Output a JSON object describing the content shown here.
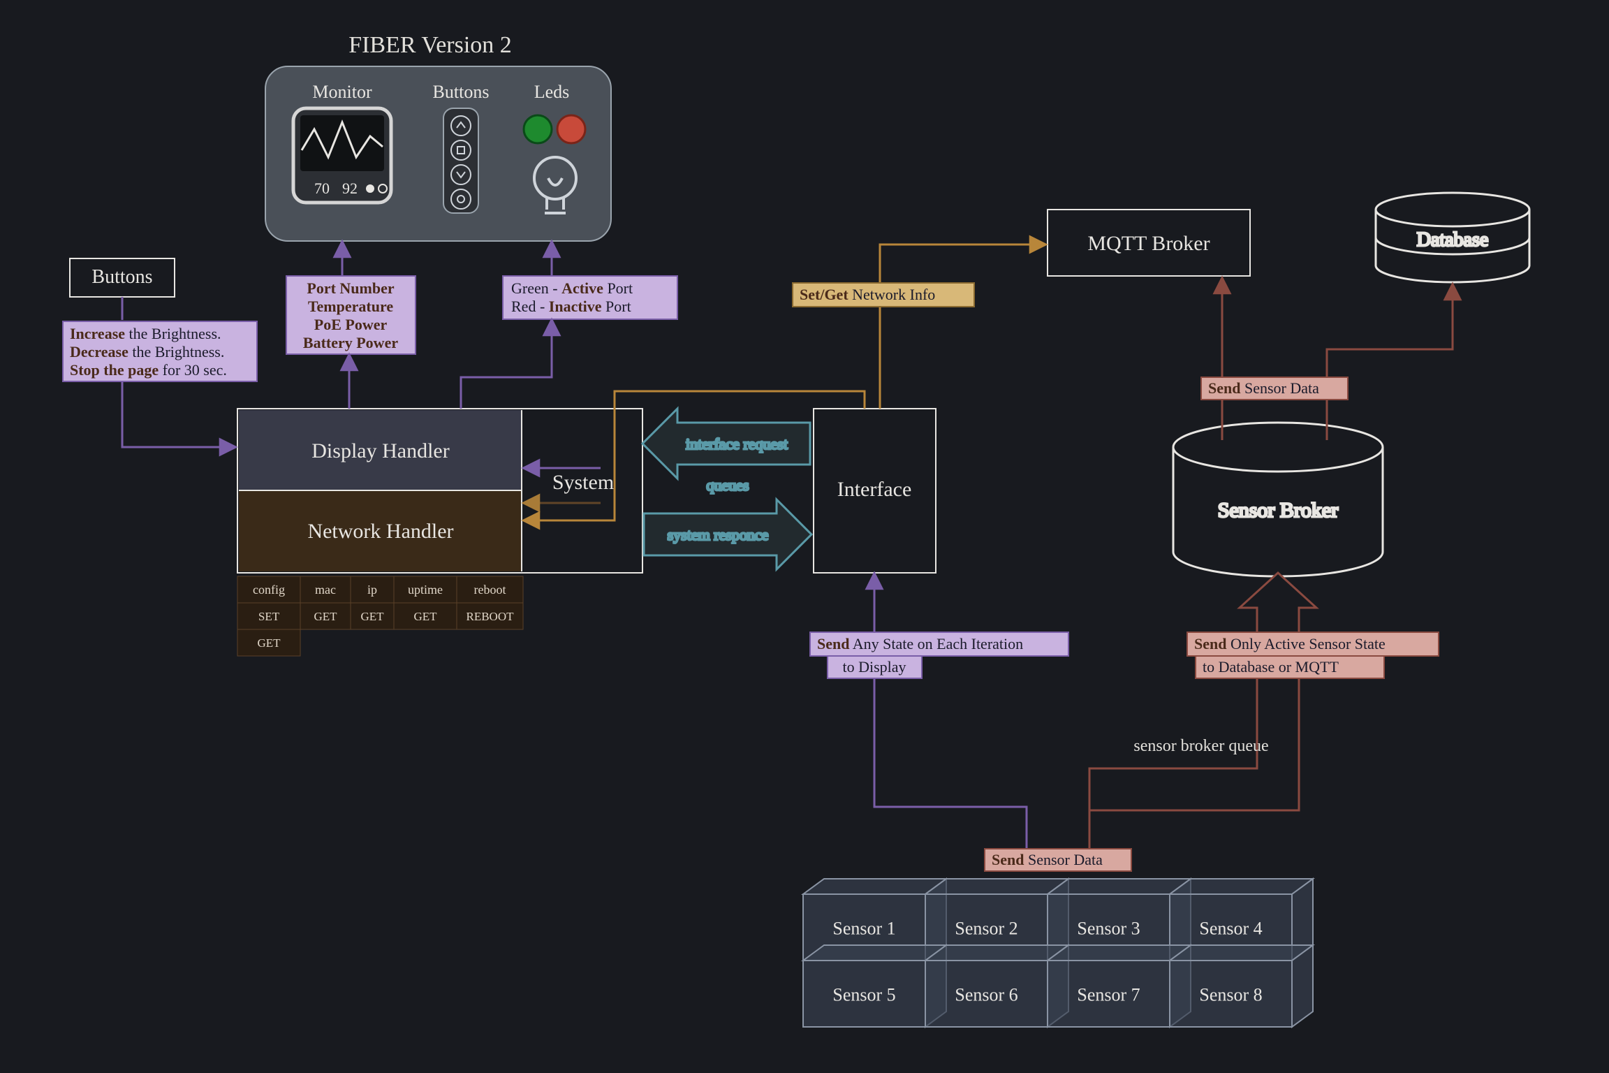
{
  "title": "FIBER Version 2",
  "device": {
    "monitor_label": "Monitor",
    "buttons_label": "Buttons",
    "leds_label": "Leds",
    "readout_a": "70",
    "readout_b": "92"
  },
  "buttons_box": {
    "label": "Buttons"
  },
  "notes": {
    "buttons": {
      "l1a": "Increase",
      "l1b": " the Brightness.",
      "l2a": "Decrease",
      "l2b": " the Brightness.",
      "l3a": "Stop the page",
      "l3b": " for 30 sec."
    },
    "monitor": {
      "l1": "Port Number",
      "l2": "Temperature",
      "l3": "PoE Power",
      "l4": "Battery Power"
    },
    "leds": {
      "l1a": "Green - ",
      "l1b": "Active",
      "l1c": " Port",
      "l2a": "Red - ",
      "l2b": "Inactive",
      "l2c": " Port"
    },
    "netinfo": {
      "a": "Set/Get",
      "b": " Network Info"
    },
    "send_display": {
      "l1a": "Send",
      "l1b": " Any State on Each Iteration",
      "l2": "to Display"
    },
    "send_active": {
      "l1a": "Send",
      "l1b": " Only Active Sensor State",
      "l2": "to Database or MQTT"
    },
    "send_sensor": {
      "a": "Send",
      "b": " Sensor Data"
    },
    "send_sensor2": {
      "a": "Send",
      "b": " Sensor Data"
    }
  },
  "system": {
    "display_handler": "Display Handler",
    "network_handler": "Network Handler",
    "system_label": "System",
    "interface_label": "Interface",
    "arrow_top": "interface request",
    "arrow_mid": "queues",
    "arrow_bot": "system responce"
  },
  "table": {
    "headers": [
      "config",
      "mac",
      "ip",
      "uptime",
      "reboot"
    ],
    "rows": [
      [
        "SET",
        "GET",
        "GET",
        "GET",
        "REBOOT"
      ],
      [
        "GET",
        "",
        "",
        "",
        ""
      ]
    ]
  },
  "mqtt": "MQTT Broker",
  "database": "Database",
  "sensor_broker": "Sensor Broker",
  "sensor_queue_label": "sensor broker queue",
  "sensors": [
    "Sensor 1",
    "Sensor 2",
    "Sensor 3",
    "Sensor 4",
    "Sensor 5",
    "Sensor 6",
    "Sensor 7",
    "Sensor 8"
  ],
  "colors": {
    "bg": "#181a1f",
    "purple": "#7a5ea8",
    "gold": "#b8863a",
    "teal": "#5a9aa8",
    "brown": "#4a3320",
    "darkslate": "#383a48",
    "brick": "#8a4a40",
    "sensorFill": "#384050",
    "sensorStroke": "#8a94a4"
  }
}
